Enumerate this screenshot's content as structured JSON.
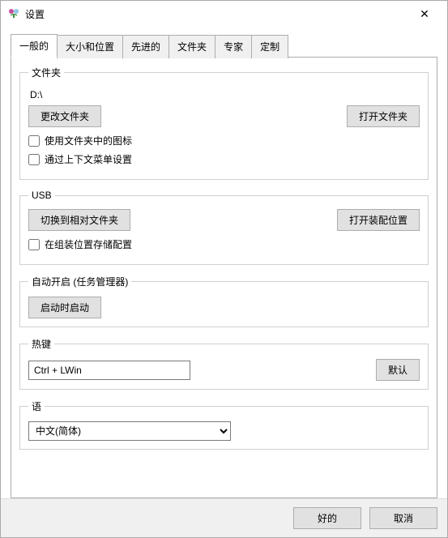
{
  "window": {
    "title": "设置"
  },
  "tabs": [
    {
      "label": "一般的",
      "active": true
    },
    {
      "label": "大小和位置"
    },
    {
      "label": "先进的"
    },
    {
      "label": "文件夹"
    },
    {
      "label": "专家"
    },
    {
      "label": "定制"
    }
  ],
  "folder_group": {
    "legend": "文件夹",
    "path": "D:\\",
    "change_folder": "更改文件夹",
    "open_folder": "打开文件夹",
    "cb_icons": "使用文件夹中的图标",
    "cb_context": "通过上下文菜单设置"
  },
  "usb_group": {
    "legend": "USB",
    "switch_relative": "切换到相对文件夹",
    "open_assembly": "打开装配位置",
    "cb_store": "在组装位置存储配置"
  },
  "autostart_group": {
    "legend": "自动开启 (任务管理器)",
    "start_on_boot": "启动时启动"
  },
  "hotkey_group": {
    "legend": "热键",
    "value": "Ctrl + LWin",
    "default": "默认"
  },
  "language_group": {
    "legend": "语",
    "selected": "中文(简体)"
  },
  "footer": {
    "ok": "好的",
    "cancel": "取消"
  }
}
